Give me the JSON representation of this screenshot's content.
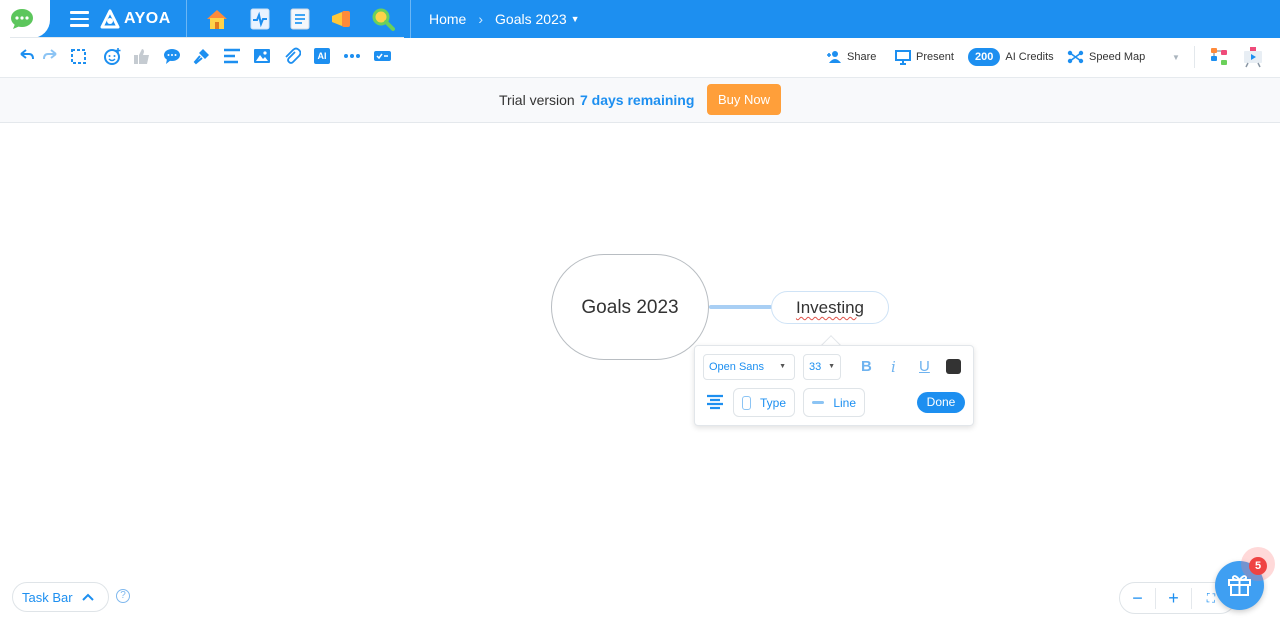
{
  "app": {
    "logo_text": "AYOA"
  },
  "breadcrumb": {
    "home": "Home",
    "current": "Goals 2023"
  },
  "toolbar": {
    "share_label": "Share",
    "present_label": "Present",
    "ai_credits_count": "200",
    "ai_credits_label": "AI Credits",
    "map_type_label": "Speed Map",
    "ai_button_label": "AI"
  },
  "banner": {
    "text": "Trial version",
    "days": "7 days remaining",
    "buy_label": "Buy Now"
  },
  "map": {
    "central_node": "Goals 2023",
    "child_node": "Investing"
  },
  "format_popover": {
    "font_family": "Open Sans",
    "font_size": "33",
    "bold_label": "B",
    "italic_label": "i",
    "underline_label": "U",
    "text_color": "#333333",
    "type_label": "Type",
    "line_label": "Line",
    "done_label": "Done"
  },
  "bottom": {
    "taskbar_label": "Task Bar",
    "help_label": "?",
    "gift_badge": "5"
  },
  "colors": {
    "brand": "#1d8ff0",
    "cta": "#ff9f3a",
    "badge": "#ef4343"
  }
}
